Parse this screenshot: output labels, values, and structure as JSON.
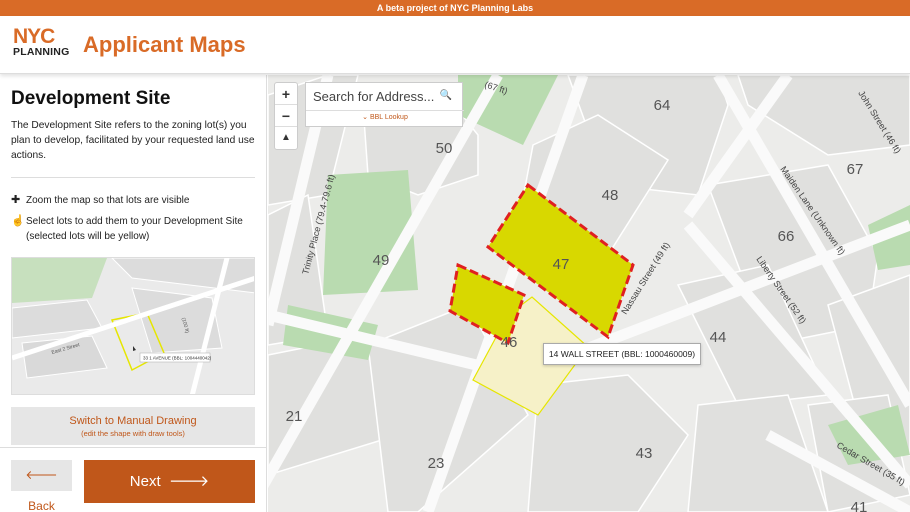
{
  "banner": "A beta project of NYC Planning Labs",
  "logo": {
    "line1": "NYC",
    "line2": "PLANNING"
  },
  "app_title": "Applicant Maps",
  "sidebar": {
    "title": "Development Site",
    "description": "The Development Site refers to the zoning lot(s) you plan to develop, facilitated by your requested land use actions.",
    "instructions": [
      {
        "icon": "plus-icon",
        "text": "Zoom the map so that lots are visible"
      },
      {
        "icon": "hand-pointer-icon",
        "text": "Select lots to add them to your Development Site (selected lots will be yellow)"
      }
    ],
    "thumbnail": {
      "street_label": "East 2 Street",
      "tooltip": "33 1 AVENUE (BBL: 1004440042)"
    },
    "manual_button": {
      "label": "Switch to Manual Drawing",
      "sublabel": "(edit the shape with draw tools)"
    },
    "back_label": "Back",
    "next_label": "Next"
  },
  "map": {
    "zoom_in": "+",
    "zoom_out": "−",
    "compass": "▲",
    "search_placeholder": "Search for Address...",
    "bbl_lookup": "BBL Lookup",
    "tooltip": "14 WALL STREET (BBL: 1000460009)",
    "lot_labels": [
      "64",
      "50",
      "48",
      "67",
      "47",
      "49",
      "66",
      "46",
      "44",
      "21",
      "23",
      "43",
      "41"
    ],
    "street_labels": [
      "(67 ft)",
      "John Street (46 ft)",
      "Trinity Place (79.4-79.6 ft)",
      "Nassau Street (49 ft)",
      "Maiden Lane (Unknown ft)",
      "Liberty Street (52 ft)",
      "Cedar Street (35 ft)"
    ],
    "colors": {
      "selected_fill": "#d8d800",
      "selected_border": "#e02020",
      "hover_border": "#e6e600",
      "park": "#b9dbb0"
    }
  }
}
